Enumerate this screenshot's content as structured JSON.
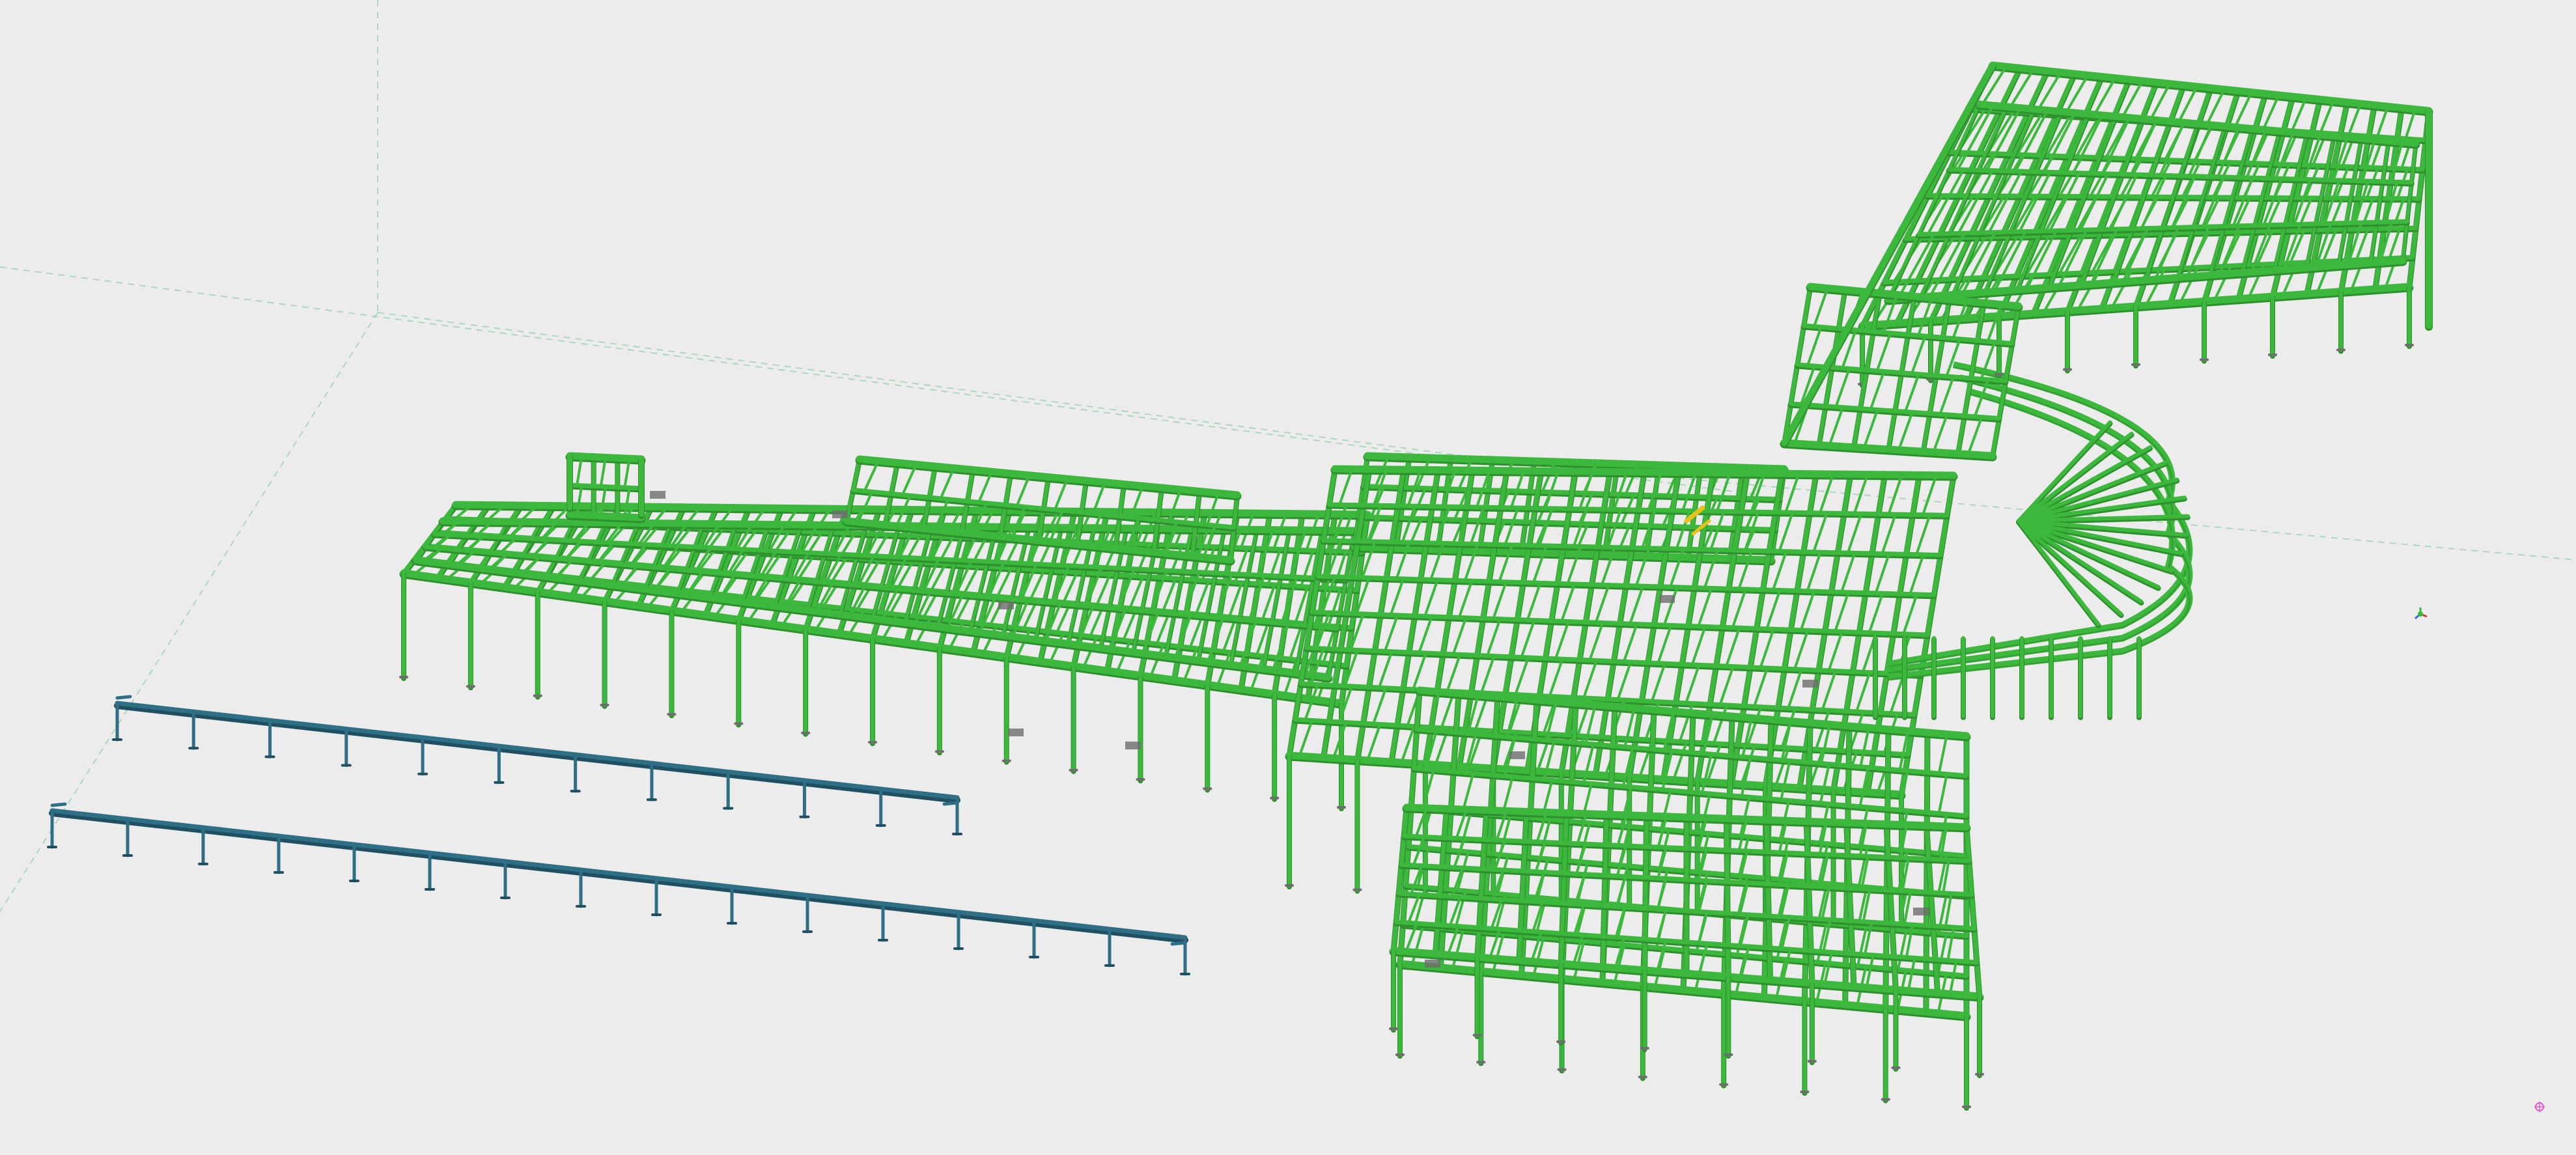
{
  "viewport": {
    "background_color": "#ececec",
    "guide_line_color": "#8fd0a8"
  },
  "model": {
    "main_structure_color": "#3cb83c",
    "main_structure_dark": "#2f8f2f",
    "secondary_member_color": "#6e6e6e",
    "highlight_member_color": "#e8c21c",
    "rail_color": "#2e6f86",
    "rail_dark": "#1f4f61",
    "rail_post_counts": [
      12,
      16
    ]
  },
  "gizmo": {
    "icon": "axis-gizmo-icon",
    "colors": [
      "#3cb83c",
      "#d23c3c",
      "#3c6cd2"
    ]
  },
  "snap_marker": {
    "icon": "snap-point-icon",
    "color": "#e05ac8"
  }
}
